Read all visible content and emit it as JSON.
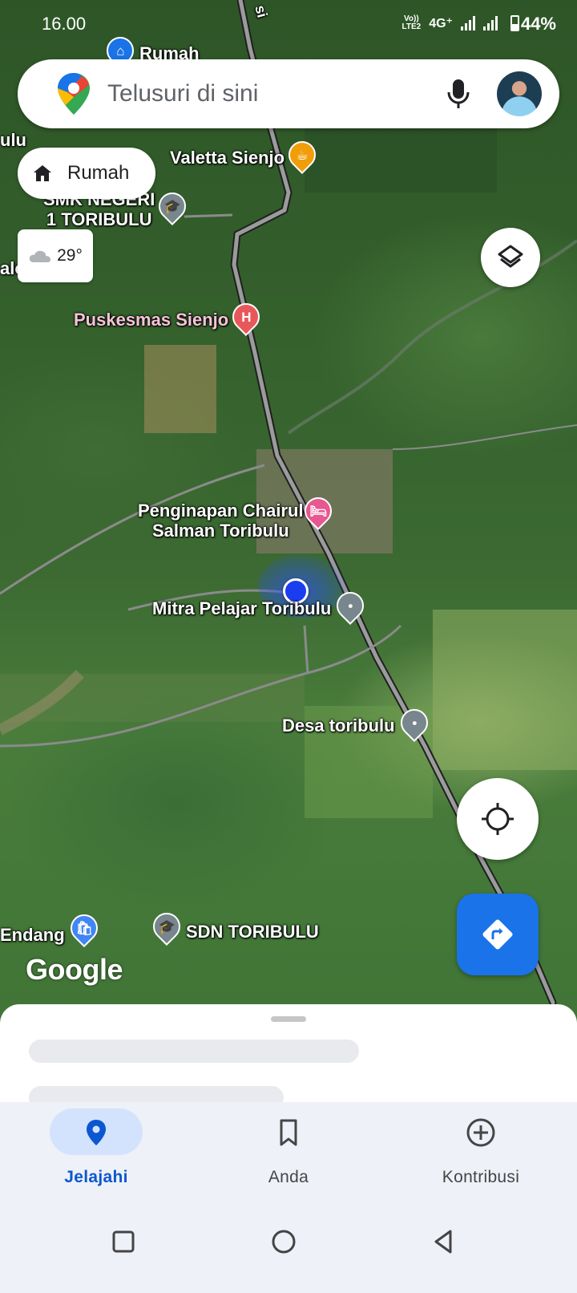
{
  "status_bar": {
    "time": "16.00",
    "network": "4G⁺",
    "volte": "Vo))\nLTE2",
    "battery": "44%"
  },
  "search": {
    "placeholder": "Telusuri di sini",
    "icons": [
      "google-maps-logo",
      "mic-icon",
      "avatar"
    ]
  },
  "chips": {
    "home": "Rumah",
    "weather": "29°"
  },
  "map": {
    "labels": {
      "rumah_top": "Rumah",
      "valetta": "Valetta Sienjo",
      "smk": "SMK NEGERI\n1 TORIBULU",
      "puskesmas": "Puskesmas Sienjo",
      "penginapan_line1": "Penginapan Chairul",
      "penginapan_line2": "Salman Toribulu",
      "mitra": "Mitra Pelajar Toribulu",
      "desa": "Desa toribulu",
      "endang": "Endang",
      "sdn": "SDN TORIBULU",
      "edge_left_top": "ulu",
      "edge_left_mid": "alo",
      "road_si": "si"
    },
    "watermark": "Google"
  },
  "nav": {
    "tabs": [
      {
        "label": "Jelajahi",
        "active": true
      },
      {
        "label": "Anda",
        "active": false
      },
      {
        "label": "Kontribusi",
        "active": false
      }
    ]
  },
  "colors": {
    "accent": "#0b57d0",
    "directions_bg": "#1a73e8",
    "nav_bg": "#eef1f7",
    "active_pill": "#d3e3fd"
  }
}
